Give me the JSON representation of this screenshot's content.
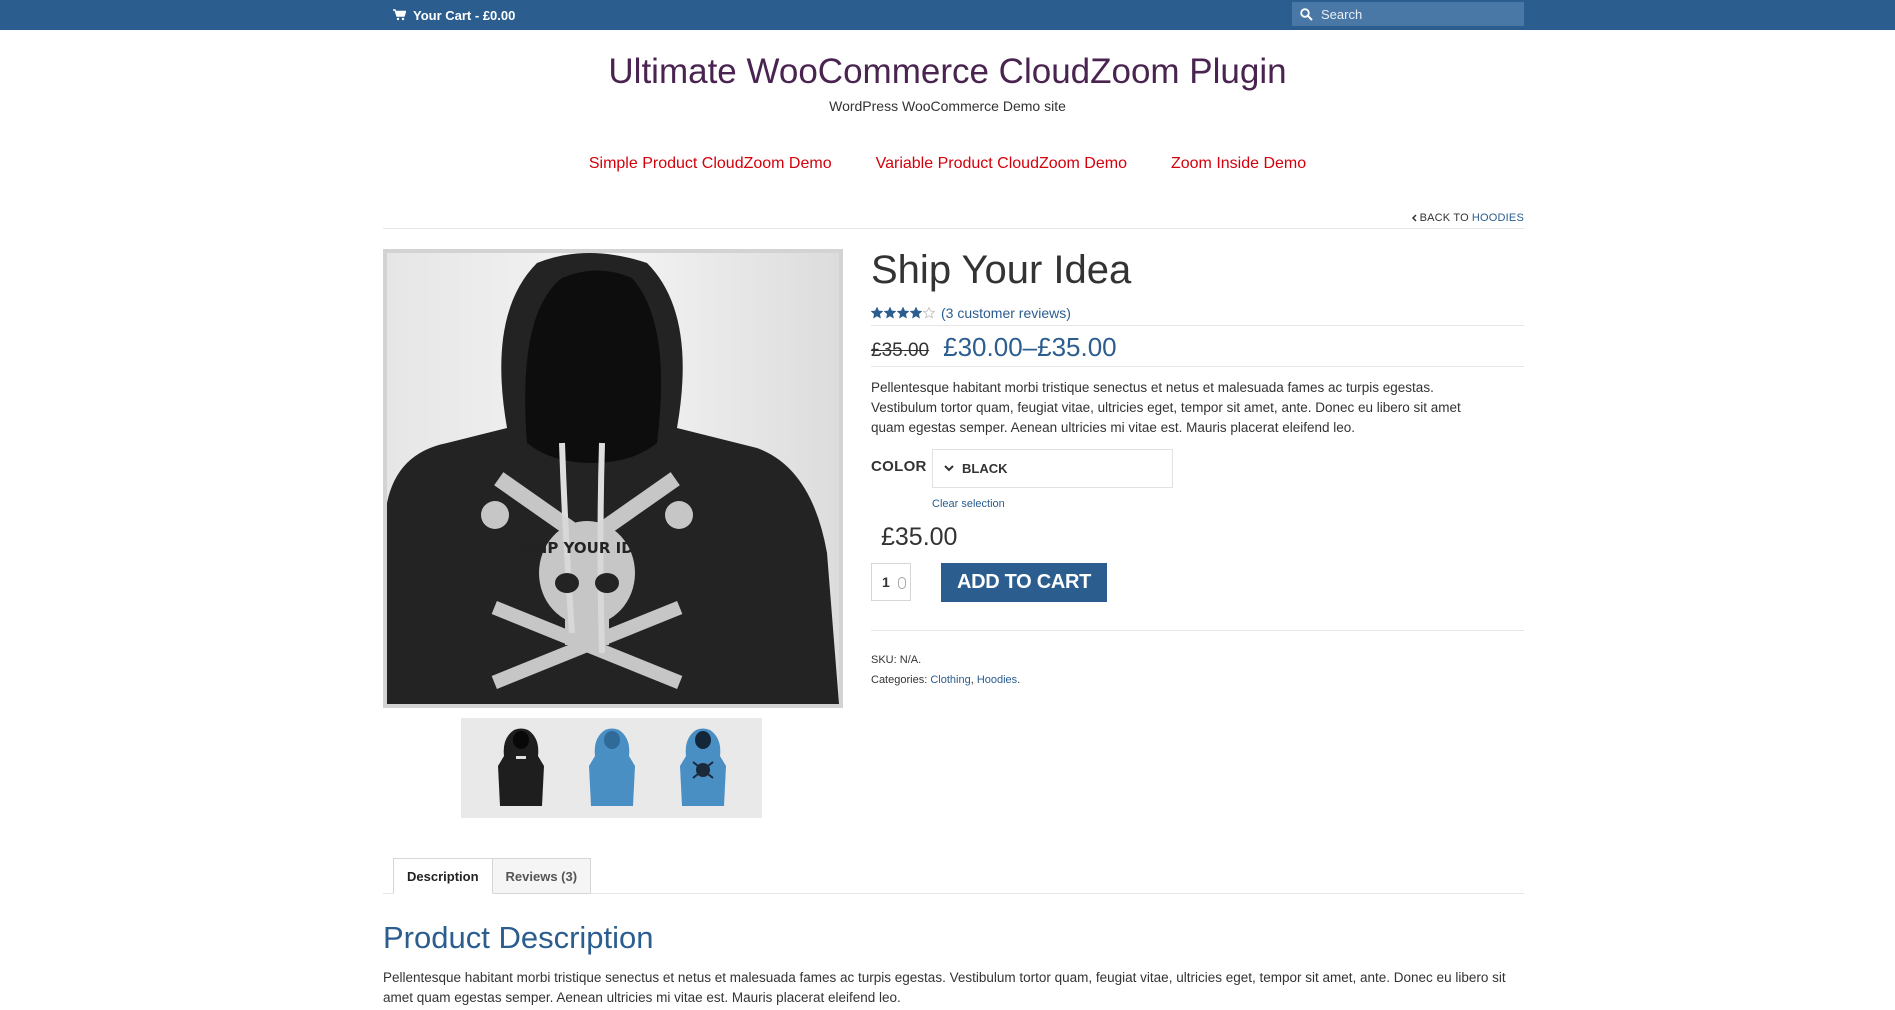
{
  "topbar": {
    "cart_label": "Your Cart - £0.00",
    "search_placeholder": "Search"
  },
  "header": {
    "site_title": "Ultimate WooCommerce CloudZoom Plugin",
    "tagline": "WordPress WooCommerce Demo site"
  },
  "nav": {
    "items": [
      {
        "label": "Simple Product CloudZoom Demo"
      },
      {
        "label": "Variable Product CloudZoom Demo"
      },
      {
        "label": "Zoom Inside Demo"
      }
    ]
  },
  "breadcrumb": {
    "prefix": "BACK TO",
    "link": "HOODIES"
  },
  "product": {
    "title": "Ship Your Idea",
    "rating": 4,
    "rating_max": 5,
    "reviews_link": "(3 customer reviews)",
    "old_price": "£35.00",
    "price_range": "£30.00–£35.00",
    "short_description": "Pellentesque habitant morbi tristique senectus et netus et malesuada fames ac turpis egestas. Vestibulum tortor quam, feugiat vitae, ultricies eget, tempor sit amet, ante. Donec eu libero sit amet quam egestas semper. Aenean ultricies mi vitae est. Mauris placerat eleifend leo.",
    "color_label": "COLOR",
    "color_value": "BLACK",
    "clear_selection": "Clear selection",
    "variation_price": "£35.00",
    "quantity": "1",
    "add_to_cart": "ADD TO CART",
    "sku_label": "SKU:",
    "sku_value": "N/A.",
    "categories_label": "Categories:",
    "categories": [
      "Clothing",
      "Hoodies"
    ],
    "categories_sep": ",",
    "categories_end": "."
  },
  "gallery": {
    "main_image_text": "SHIP YOUR IDEA",
    "thumbs": [
      {
        "name": "black-hoodie",
        "color": "#1e1e1e"
      },
      {
        "name": "blue-hoodie",
        "color": "#4a8fc4"
      },
      {
        "name": "blue-hoodie-print",
        "color": "#4a8fc4"
      }
    ]
  },
  "tabs": {
    "items": [
      {
        "label": "Description"
      },
      {
        "label": "Reviews (3)"
      }
    ]
  },
  "description": {
    "heading": "Product Description",
    "body": "Pellentesque habitant morbi tristique senectus et netus et malesuada fames ac turpis egestas. Vestibulum tortor quam, feugiat vitae, ultricies eget, tempor sit amet, ante. Donec eu libero sit amet quam egestas semper. Aenean ultricies mi vitae est. Mauris placerat eleifend leo."
  },
  "colors": {
    "topbar": "#2b5d8f",
    "accent": "#2b5d8f",
    "nav_link": "#d4000b",
    "site_title": "#4a2450"
  }
}
